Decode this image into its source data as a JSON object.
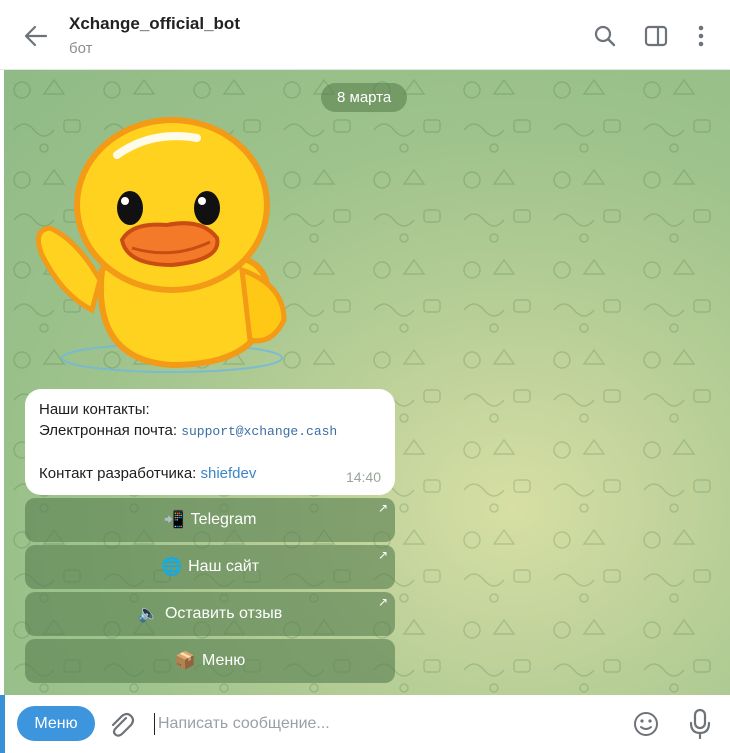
{
  "header": {
    "title": "Xchange_official_bot",
    "subtitle": "бот"
  },
  "chat": {
    "date": "8 марта",
    "message": {
      "line1": "Наши контакты:",
      "email_label": "Электронная почта:",
      "email": "support@xchange.cash",
      "dev_label": "Контакт разработчика:",
      "dev_link": "shiefdev",
      "time": "14:40"
    },
    "buttons": [
      {
        "emoji": "📲",
        "label": "Telegram",
        "external": true
      },
      {
        "emoji": "🌐",
        "label": "Наш сайт",
        "external": true
      },
      {
        "emoji": "🔈",
        "label": "Оставить отзыв",
        "external": true
      },
      {
        "emoji": "📦",
        "label": "Меню",
        "external": false
      }
    ],
    "external_marker": "↗"
  },
  "composer": {
    "menu_label": "Меню",
    "placeholder": "Написать сообщение...",
    "value": ""
  },
  "icons": {
    "back": "arrow-left-icon",
    "search": "search-icon",
    "sidebar": "sidebar-toggle-icon",
    "more": "more-vertical-icon",
    "attach": "paperclip-icon",
    "emoji": "smiley-icon",
    "mic": "microphone-icon"
  },
  "colors": {
    "accent": "#3d95dd",
    "chat_bg": "#a8c790",
    "button_bg": "#5f8a55",
    "link": "#3a85c7"
  }
}
